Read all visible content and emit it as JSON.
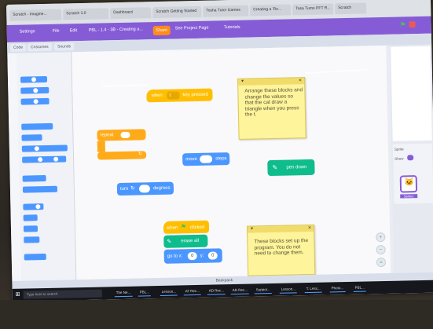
{
  "browser": {
    "tabs": [
      "Scratch - Imagine...",
      "Scratch 3.0",
      "Dashboard",
      "Scratch Getting Started",
      "Tosha Tutor Games",
      "Creating a 'Ro...",
      "Tosa Turns PFT R...",
      "Scratch"
    ]
  },
  "menubar": {
    "settings_label": "Settings",
    "file_label": "File",
    "edit_label": "Edit",
    "project_title": "PBL - 1.4 - 3B - Creating a...",
    "share_label": "Share",
    "see_project_page_label": "See Project Page",
    "tutorials_label": "Tutorials"
  },
  "subbar": {
    "code_tab": "Code",
    "costumes_tab": "Costumes",
    "sounds_tab": "Sounds"
  },
  "blocks": {
    "hat_when_label": "when",
    "hat_key_value": "t",
    "hat_key_pressed_label": "key pressed",
    "repeat_label": "repeat",
    "move_label": "move",
    "move_value": "",
    "steps_label": "steps",
    "pen_down_label": "pen down",
    "turn_label": "turn",
    "turn_value": "",
    "degrees_label": "degrees",
    "flag_when_label": "when",
    "flag_clicked_label": "clicked",
    "erase_all_label": "erase all",
    "goto_label": "go to x:",
    "goto_x": "0",
    "goto_y_label": "y:",
    "goto_y": "0"
  },
  "notes": {
    "note1_text": "Arrange these blocks and change the values so that the cat draw a triangle when you press the t.",
    "note2_text": "These blocks set up the program. You do not need to change them."
  },
  "sprite_pane": {
    "sprite_label": "Sprite",
    "show_label": "Show",
    "sprite_name": "Sprite1"
  },
  "statusbar": {
    "backpack_label": "Backpack"
  },
  "taskbar": {
    "search_placeholder": "Type here to search",
    "items": [
      "The Ne...",
      "PBL...",
      "Lesson...",
      "AT Rec...",
      "AD Rec...",
      "AD Rec...",
      "Suppor...",
      "Lesson...",
      "T. Less...",
      "Photo...",
      "PBL..."
    ]
  },
  "colors": {
    "scratch_purple": "#855cd6",
    "motion_blue": "#4c97ff",
    "events_yellow": "#ffbf00",
    "control_orange": "#ffab19",
    "pen_green": "#0fbd8c",
    "note_yellow": "#fef49c"
  }
}
